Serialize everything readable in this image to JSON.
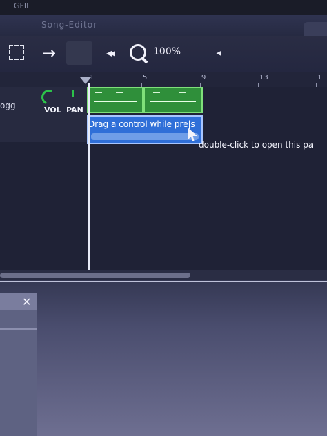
{
  "window": {
    "top_text": "GFII",
    "title": "Song-Editor"
  },
  "toolbar": {
    "select_icon": "dashed-square-icon",
    "move_arrow": "→",
    "rewind_glyph": "◂◂",
    "zoom_icon": "magnifier-icon",
    "zoom_level": "100%",
    "scroll_left_glyph": "◂"
  },
  "ruler": {
    "labels": [
      "1",
      "5",
      "9",
      "13",
      "1"
    ]
  },
  "track": {
    "name": "ogg",
    "vol_label": "VOL",
    "pan_label": "PAN",
    "accent": "#2cc24a"
  },
  "tooltip": {
    "text": "Drag a control while pre|s",
    "hint": "double-click to open this pa"
  },
  "panel": {
    "close_glyph": "✕"
  }
}
